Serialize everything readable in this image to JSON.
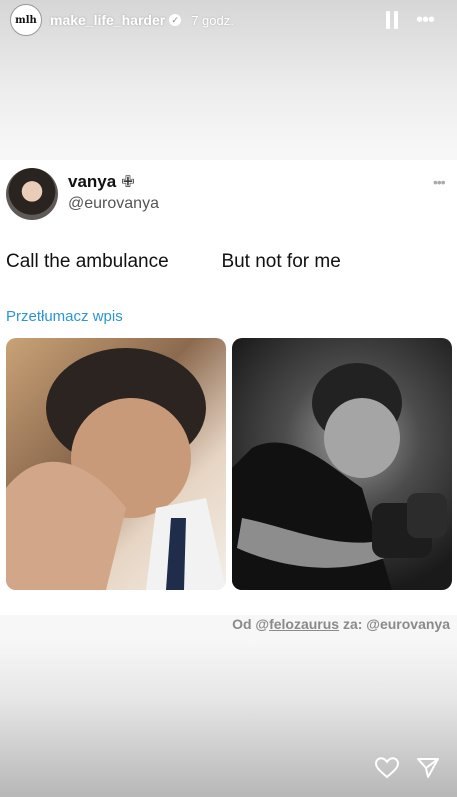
{
  "story_header": {
    "avatar_text": "mlh",
    "username": "make_life_harder",
    "time": "7 godz."
  },
  "tweet": {
    "display_name": "vanya",
    "handle": "@eurovanya",
    "text": "Call the ambulance          But not for me",
    "translate_label": "Przetłumacz wpis"
  },
  "credit": {
    "prefix": "Od @",
    "from_user": "felozaurus",
    "suffix": " za: @eurovanya"
  },
  "icons": {
    "verified": "verified-badge-icon",
    "pause": "pause-icon",
    "more": "more-icon",
    "cross": "cross-icon",
    "heart": "heart-icon",
    "send": "send-icon"
  }
}
